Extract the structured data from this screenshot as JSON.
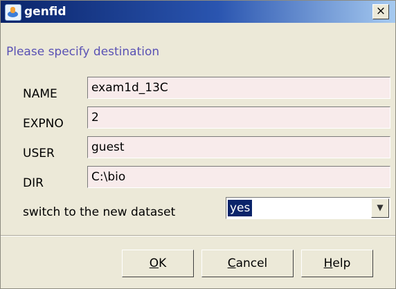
{
  "window": {
    "title": "genfid",
    "close_glyph": "×"
  },
  "prompt": "Please specify destination",
  "fields": [
    {
      "label": "NAME",
      "value": "exam1d_13C"
    },
    {
      "label": "EXPNO",
      "value": "2"
    },
    {
      "label": "USER",
      "value": "guest"
    },
    {
      "label": "DIR",
      "value": "C:\\bio"
    }
  ],
  "switch": {
    "label": "switch to the new dataset",
    "value": "yes"
  },
  "buttons": {
    "ok": {
      "mnemonic": "O",
      "rest": "K"
    },
    "cancel": {
      "mnemonic": "C",
      "rest": "ancel"
    },
    "help": {
      "mnemonic": "H",
      "rest": "elp"
    }
  },
  "icons": {
    "app": "genfid-app-icon",
    "close": "close-icon",
    "dropdown": "chevron-down-icon"
  },
  "colors": {
    "title_bar": "#0a246a",
    "prompt_text": "#5a52b4",
    "field_bg": "#f8ebeb",
    "selection": "#0a246a"
  }
}
